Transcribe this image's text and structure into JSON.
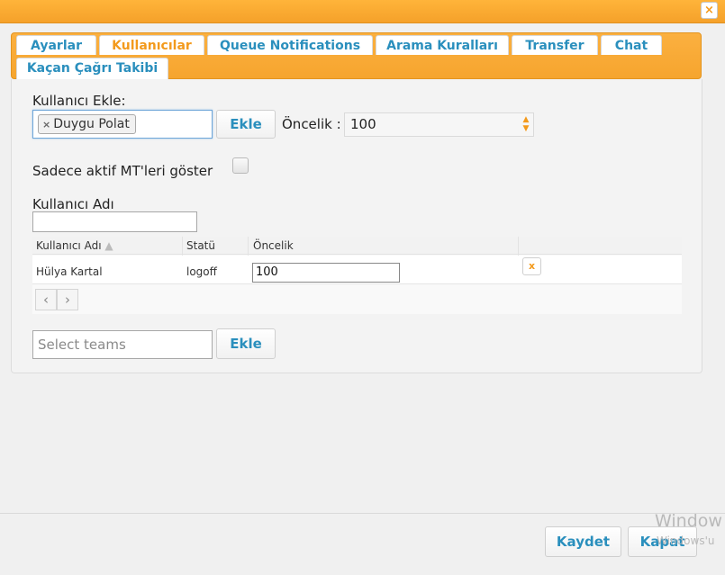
{
  "dialog": {
    "close_symbol": "×"
  },
  "tabs": [
    {
      "label": "Ayarlar",
      "active": false
    },
    {
      "label": "Kullanıcılar",
      "active": true
    },
    {
      "label": "Queue Notifications",
      "active": false
    },
    {
      "label": "Arama Kuralları",
      "active": false
    },
    {
      "label": "Transfer",
      "active": false
    },
    {
      "label": "Chat",
      "active": false
    },
    {
      "label": "Kaçan Çağrı Takibi",
      "active": false
    }
  ],
  "add_user": {
    "label": "Kullanıcı Ekle:",
    "selected_tag": "Duygu Polat",
    "add_button": "Ekle",
    "priority_label": "Öncelik :",
    "priority_value": "100"
  },
  "filter": {
    "only_active_label": "Sadece aktif MT'leri göster",
    "only_active_checked": false
  },
  "username_search": {
    "label": "Kullanıcı Adı",
    "value": ""
  },
  "grid": {
    "columns": [
      "Kullanıcı Adı",
      "Statü",
      "Öncelik"
    ],
    "sort_indicator": "▲",
    "rows": [
      {
        "name": "Hülya Kartal",
        "status": "logoff",
        "priority": "100",
        "delete_symbol": "x"
      }
    ],
    "prev_symbol": "‹",
    "next_symbol": "›"
  },
  "teams": {
    "placeholder": "Select teams",
    "add_button": "Ekle"
  },
  "footer": {
    "save_button": "Kaydet",
    "close_button": "Kapat"
  },
  "watermark": {
    "line1": "Window",
    "line2": "Windows'u"
  },
  "colors": {
    "accent_orange": "#f6a52e",
    "link_blue": "#2a8fbd"
  }
}
